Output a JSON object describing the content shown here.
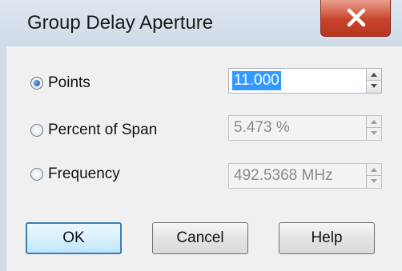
{
  "window": {
    "title": "Group Delay Aperture",
    "close_glyph": "X"
  },
  "options": [
    {
      "label": "Points",
      "checked": true,
      "value": "11.000",
      "enabled": true
    },
    {
      "label": "Percent of Span",
      "checked": false,
      "value": "5.473 %",
      "enabled": false
    },
    {
      "label": "Frequency",
      "checked": false,
      "value": "492.5368 MHz",
      "enabled": false
    }
  ],
  "buttons": {
    "ok": "OK",
    "cancel": "Cancel",
    "help": "Help"
  }
}
